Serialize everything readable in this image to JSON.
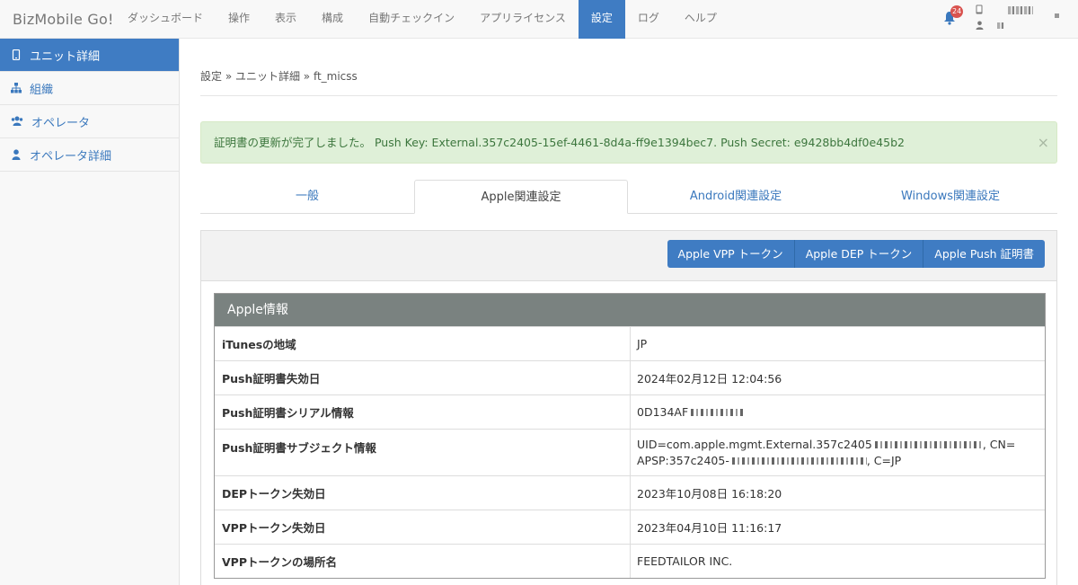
{
  "app": {
    "brand": "BizMobile Go!"
  },
  "nav": {
    "items": [
      {
        "label": "ダッシュボード"
      },
      {
        "label": "操作"
      },
      {
        "label": "表示"
      },
      {
        "label": "構成"
      },
      {
        "label": "自動チェックイン"
      },
      {
        "label": "アプリライセンス"
      },
      {
        "label": "設定"
      },
      {
        "label": "ログ"
      },
      {
        "label": "ヘルプ"
      }
    ],
    "active_index": 6,
    "notification_count": "24"
  },
  "sidebar": {
    "items": [
      {
        "label": "ユニット詳細",
        "icon": "device-icon"
      },
      {
        "label": "組織",
        "icon": "sitemap-icon"
      },
      {
        "label": "オペレータ",
        "icon": "users-icon"
      },
      {
        "label": "オペレータ詳細",
        "icon": "user-icon"
      }
    ],
    "active_index": 0
  },
  "breadcrumb": "設定 » ユニット詳細 » ft_micss",
  "alert": {
    "text": "証明書の更新が完了しました。 Push Key: External.357c2405-15ef-4461-8d4a-ff9e1394bec7. Push Secret: e9428bb4df0e45b2",
    "close": "×"
  },
  "tabs": [
    {
      "label": "一般"
    },
    {
      "label": "Apple関連設定"
    },
    {
      "label": "Android関連設定"
    },
    {
      "label": "Windows関連設定"
    }
  ],
  "buttons": {
    "vpp": "Apple VPP トークン",
    "dep": "Apple DEP トークン",
    "push": "Apple Push 証明書"
  },
  "apple_info": {
    "title": "Apple情報",
    "rows": [
      {
        "key": "iTunesの地域",
        "value": "JP"
      },
      {
        "key": "Push証明書失効日",
        "value": "2024年02月12日 12:04:56"
      },
      {
        "key": "Push証明書シリアル情報",
        "value": "0D134AF"
      },
      {
        "key": "Push証明書サブジェクト情報",
        "value_line1": "UID=com.apple.mgmt.External.357c2405",
        "value_line1_end": ", CN=",
        "value_line2": "APSP:357c2405-",
        "value_line2_end": ", C=JP"
      },
      {
        "key": "DEPトークン失効日",
        "value": "2023年10月08日 16:18:20"
      },
      {
        "key": "VPPトークン失効日",
        "value": "2023年04月10日 11:16:17"
      },
      {
        "key": "VPPトークンの場所名",
        "value": "FEEDTAILOR INC."
      }
    ]
  },
  "colors": {
    "primary": "#3f7cc3",
    "alert_bg": "#dff0d8",
    "table_header": "#7a8280"
  }
}
